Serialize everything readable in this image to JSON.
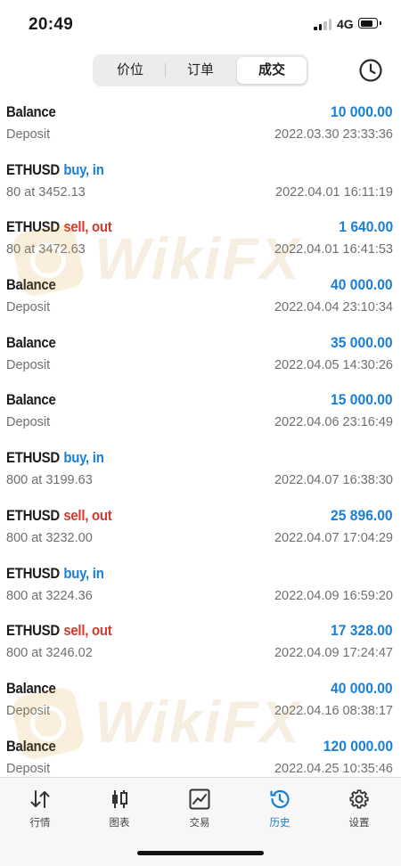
{
  "status_bar": {
    "time": "20:49",
    "network": "4G",
    "battery_level": 0.85
  },
  "tabs_top": [
    {
      "label": "价位",
      "active": false
    },
    {
      "label": "订单",
      "active": false
    },
    {
      "label": "成交",
      "active": true
    }
  ],
  "history_icon": "clock-icon",
  "deals": [
    {
      "symbol": "Balance",
      "direction": "",
      "direction_type": "",
      "profit": "10 000.00",
      "detail": "Deposit",
      "time": "2022.03.30 23:33:36"
    },
    {
      "symbol": "ETHUSD",
      "direction": "buy, in",
      "direction_type": "buy",
      "profit": "",
      "detail": "80 at 3452.13",
      "time": "2022.04.01 16:11:19"
    },
    {
      "symbol": "ETHUSD",
      "direction": "sell, out",
      "direction_type": "sell",
      "profit": "1 640.00",
      "detail": "80 at 3472.63",
      "time": "2022.04.01 16:41:53"
    },
    {
      "symbol": "Balance",
      "direction": "",
      "direction_type": "",
      "profit": "40 000.00",
      "detail": "Deposit",
      "time": "2022.04.04 23:10:34"
    },
    {
      "symbol": "Balance",
      "direction": "",
      "direction_type": "",
      "profit": "35 000.00",
      "detail": "Deposit",
      "time": "2022.04.05 14:30:26"
    },
    {
      "symbol": "Balance",
      "direction": "",
      "direction_type": "",
      "profit": "15 000.00",
      "detail": "Deposit",
      "time": "2022.04.06 23:16:49"
    },
    {
      "symbol": "ETHUSD",
      "direction": "buy, in",
      "direction_type": "buy",
      "profit": "",
      "detail": "800 at 3199.63",
      "time": "2022.04.07 16:38:30"
    },
    {
      "symbol": "ETHUSD",
      "direction": "sell, out",
      "direction_type": "sell",
      "profit": "25 896.00",
      "detail": "800 at 3232.00",
      "time": "2022.04.07 17:04:29"
    },
    {
      "symbol": "ETHUSD",
      "direction": "buy, in",
      "direction_type": "buy",
      "profit": "",
      "detail": "800 at 3224.36",
      "time": "2022.04.09 16:59:20"
    },
    {
      "symbol": "ETHUSD",
      "direction": "sell, out",
      "direction_type": "sell",
      "profit": "17 328.00",
      "detail": "800 at 3246.02",
      "time": "2022.04.09 17:24:47"
    },
    {
      "symbol": "Balance",
      "direction": "",
      "direction_type": "",
      "profit": "40 000.00",
      "detail": "Deposit",
      "time": "2022.04.16 08:38:17"
    },
    {
      "symbol": "Balance",
      "direction": "",
      "direction_type": "",
      "profit": "120 000.00",
      "detail": "Deposit",
      "time": "2022.04.25 10:35:46"
    }
  ],
  "watermark": {
    "text": "WikiFX"
  },
  "tab_bar": [
    {
      "label": "行情",
      "icon": "sort-arrows-icon",
      "active": false
    },
    {
      "label": "图表",
      "icon": "candlestick-icon",
      "active": false
    },
    {
      "label": "交易",
      "icon": "trade-chart-icon",
      "active": false
    },
    {
      "label": "历史",
      "icon": "history-clock-icon",
      "active": true
    },
    {
      "label": "设置",
      "icon": "gear-icon",
      "active": false
    }
  ],
  "colors": {
    "accent": "#1a7fd6",
    "sell": "#d23a2f",
    "secondary_text": "#6f6f6f"
  }
}
